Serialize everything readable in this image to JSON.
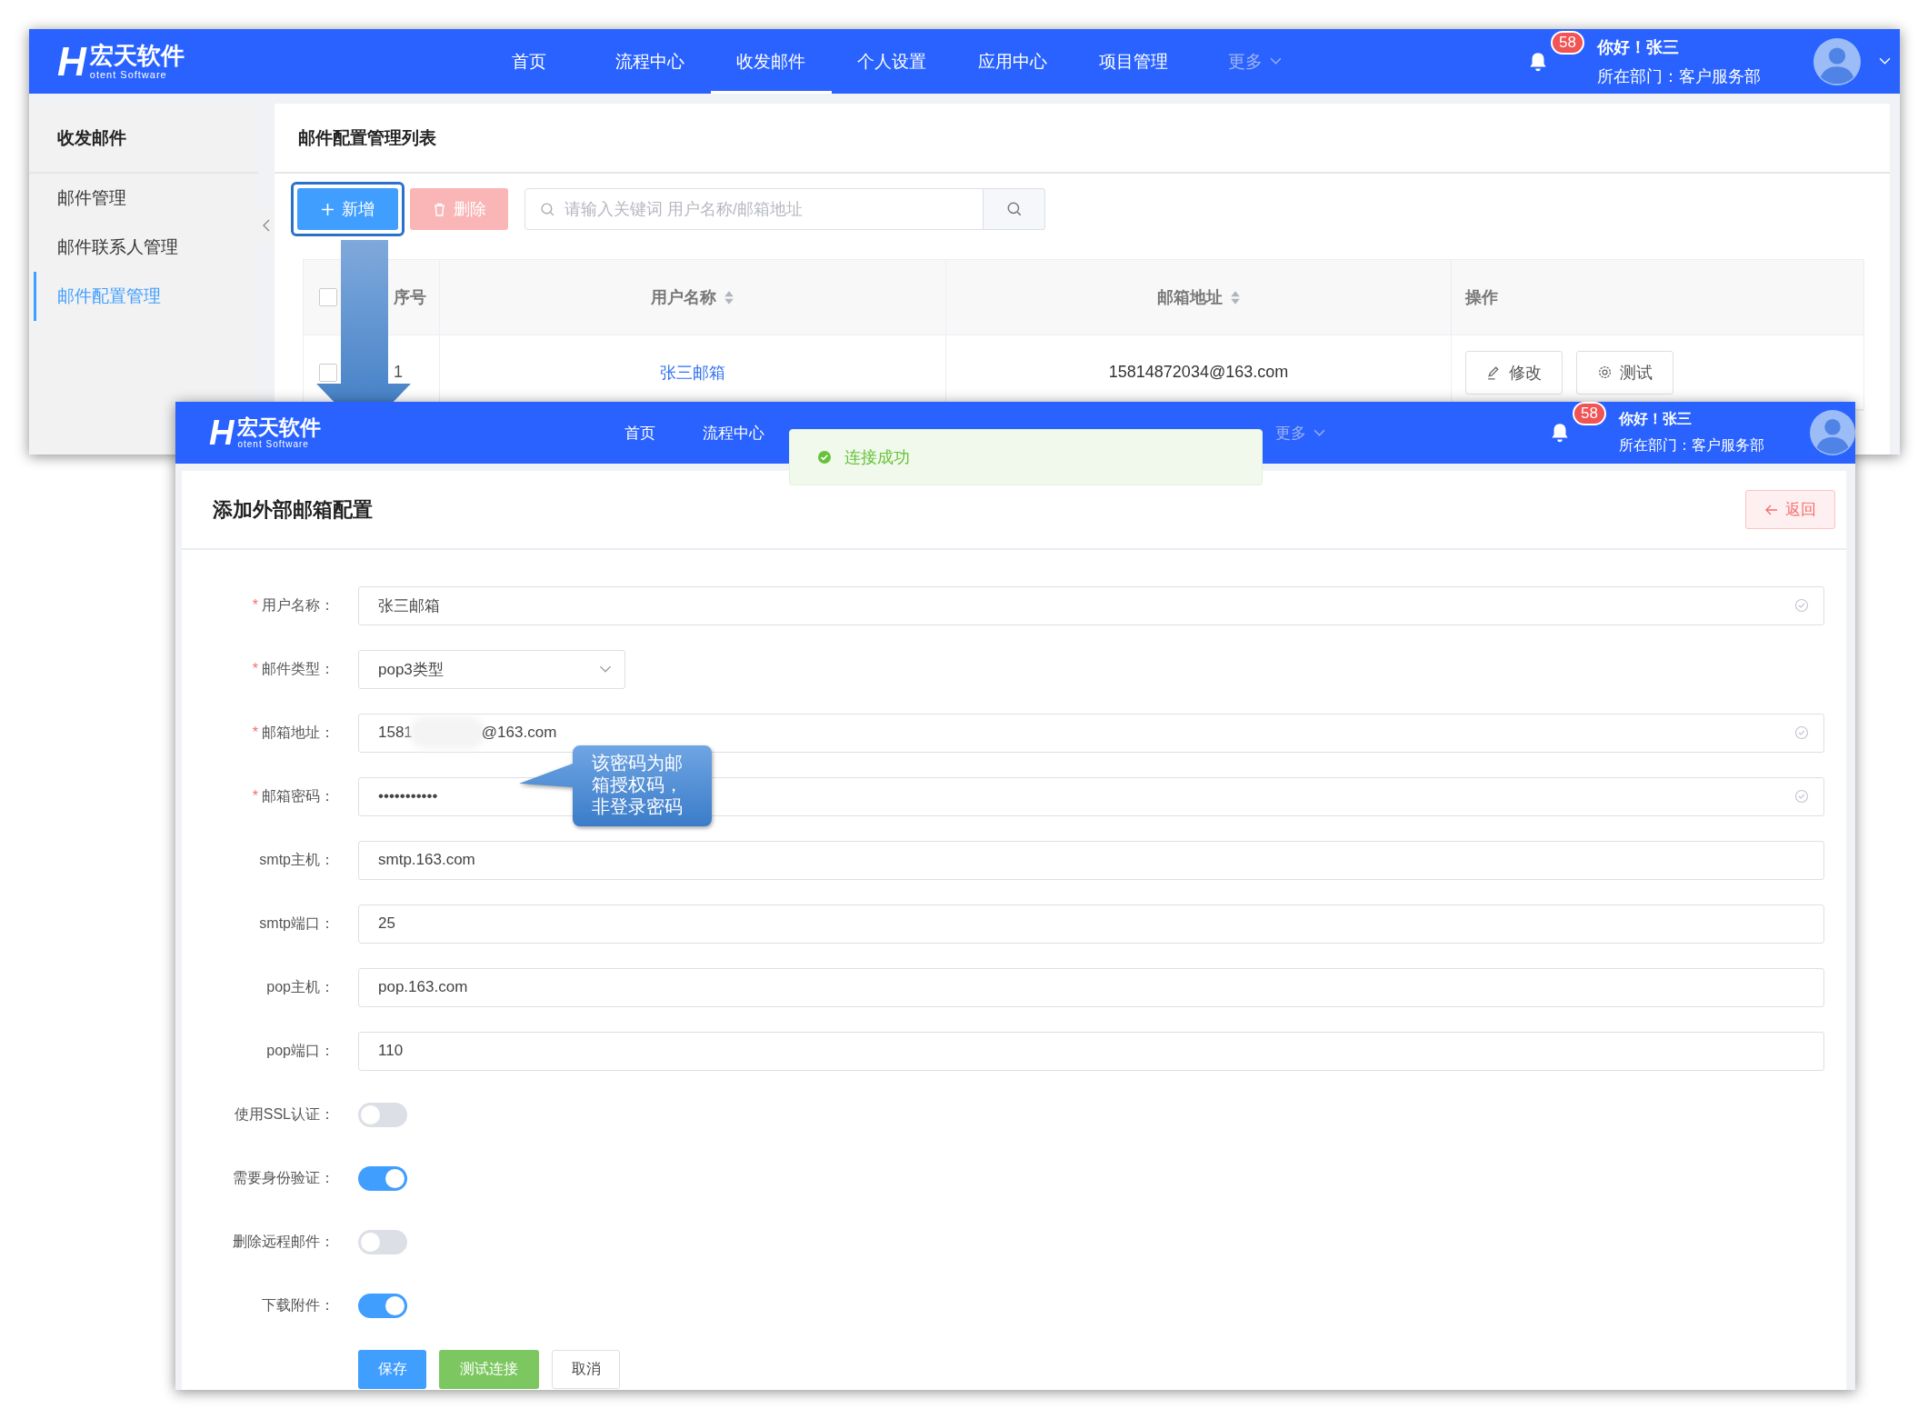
{
  "top_window": {
    "header": {
      "logo": {
        "letter": "H",
        "name": "宏天软件",
        "tagline": "otent Software"
      },
      "nav": [
        {
          "label": "首页",
          "selected": false,
          "disabled": false,
          "dropdown": false
        },
        {
          "label": "流程中心",
          "selected": false,
          "disabled": false,
          "dropdown": false
        },
        {
          "label": "收发邮件",
          "selected": true,
          "disabled": false,
          "dropdown": false
        },
        {
          "label": "个人设置",
          "selected": false,
          "disabled": false,
          "dropdown": false
        },
        {
          "label": "应用中心",
          "selected": false,
          "disabled": false,
          "dropdown": false
        },
        {
          "label": "项目管理",
          "selected": false,
          "disabled": false,
          "dropdown": false
        },
        {
          "label": "更多",
          "selected": false,
          "disabled": true,
          "dropdown": true
        }
      ],
      "notifications": "58",
      "greeting": "你好！张三",
      "department": "所在部门：客户服务部",
      "account_dropdown": true
    },
    "sidebar": {
      "title": "收发邮件",
      "items": [
        {
          "label": "邮件管理",
          "selected": false
        },
        {
          "label": "邮件联系人管理",
          "selected": false
        },
        {
          "label": "邮件配置管理",
          "selected": true
        }
      ]
    },
    "panel": {
      "title": "邮件配置管理列表",
      "add_button": "新增",
      "add_highlighted": true,
      "delete_button": "删除",
      "search_placeholder": "请输入关键词 用户名称/邮箱地址",
      "table": {
        "select_all_checked": false,
        "columns": [
          {
            "label": "序号",
            "sortable": false
          },
          {
            "label": "用户名称",
            "sortable": true
          },
          {
            "label": "邮箱地址",
            "sortable": true
          },
          {
            "label": "操作",
            "sortable": false
          }
        ],
        "rows": [
          {
            "checked": false,
            "index": "1",
            "user_name": "张三邮箱",
            "email": "15814872034@163.com",
            "actions": [
              {
                "label": "修改",
                "kind": "edit"
              },
              {
                "label": "测试",
                "kind": "test"
              }
            ]
          }
        ]
      }
    }
  },
  "callout": "该密码为邮箱授权码，非登录密码",
  "bottom_window": {
    "header": {
      "logo": {
        "letter": "H",
        "name": "宏天软件",
        "tagline": "otent Software"
      },
      "nav": [
        {
          "label": "首页",
          "selected": false,
          "disabled": false,
          "dropdown": false
        },
        {
          "label": "流程中心",
          "selected": false,
          "disabled": false,
          "dropdown": false
        },
        {
          "label": "更多",
          "selected": false,
          "disabled": true,
          "dropdown": true
        }
      ],
      "notifications": "58",
      "greeting": "你好！张三",
      "department": "所在部门：客户服务部"
    },
    "toast": {
      "kind": "success",
      "text": "连接成功"
    },
    "title": "添加外部邮箱配置",
    "back_button": "返回",
    "fields": [
      {
        "kind": "input",
        "required_mark": "*",
        "label": "用户名称：",
        "value": "张三邮箱",
        "valid": true
      },
      {
        "kind": "select",
        "required_mark": "*",
        "label": "邮件类型：",
        "value": "pop3类型"
      },
      {
        "kind": "input",
        "required_mark": "*",
        "label": "邮箱地址：",
        "value": "1581",
        "redacted": true,
        "value_end": "@163.com",
        "valid": true
      },
      {
        "kind": "input",
        "required_mark": "*",
        "label": "邮箱密码：",
        "value": "•••••••••••",
        "valid": true
      },
      {
        "kind": "input",
        "label": "smtp主机：",
        "value": "smtp.163.com",
        "valid": false
      },
      {
        "kind": "input",
        "label": "smtp端口：",
        "value": "25",
        "valid": false
      },
      {
        "kind": "input",
        "label": "pop主机：",
        "value": "pop.163.com",
        "valid": false
      },
      {
        "kind": "input",
        "label": "pop端口：",
        "value": "110",
        "valid": false
      },
      {
        "kind": "switch",
        "label": "使用SSL认证：",
        "on": false
      },
      {
        "kind": "switch",
        "label": "需要身份验证：",
        "on": true
      },
      {
        "kind": "switch",
        "label": "删除远程邮件：",
        "on": false
      },
      {
        "kind": "switch",
        "label": "下载附件：",
        "on": true
      }
    ],
    "buttons": [
      {
        "label": "保存",
        "kind": "primary"
      },
      {
        "label": "测试连接",
        "kind": "success"
      },
      {
        "label": "取消",
        "kind": "default"
      }
    ]
  }
}
